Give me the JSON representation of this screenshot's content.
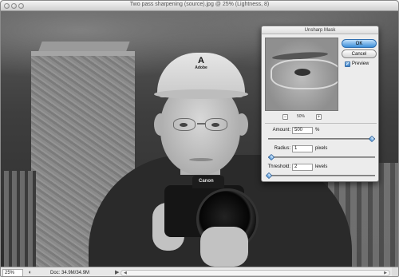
{
  "window": {
    "title": "Two pass sharpening (source).jpg @ 25% (Lightness, 8)"
  },
  "photo": {
    "cap_logo_text": "Adobe",
    "camera_brand": "Canon"
  },
  "statusbar": {
    "zoom": "25%",
    "doc_info": "Doc: 34.9M/34.9M"
  },
  "dialog": {
    "title": "Unsharp Mask",
    "ok_label": "OK",
    "cancel_label": "Cancel",
    "preview_label": "Preview",
    "preview_checked": true,
    "preview_zoom": "50%",
    "zoom_out_label": "−",
    "zoom_in_label": "+",
    "amount": {
      "label": "Amount:",
      "value": "500",
      "unit": "%",
      "level": 0.97
    },
    "radius": {
      "label": "Radius:",
      "value": "1",
      "unit": "pixels",
      "level": 0.03
    },
    "threshold": {
      "label": "Threshold:",
      "value": "2",
      "unit": "levels",
      "level": 0.01
    }
  }
}
